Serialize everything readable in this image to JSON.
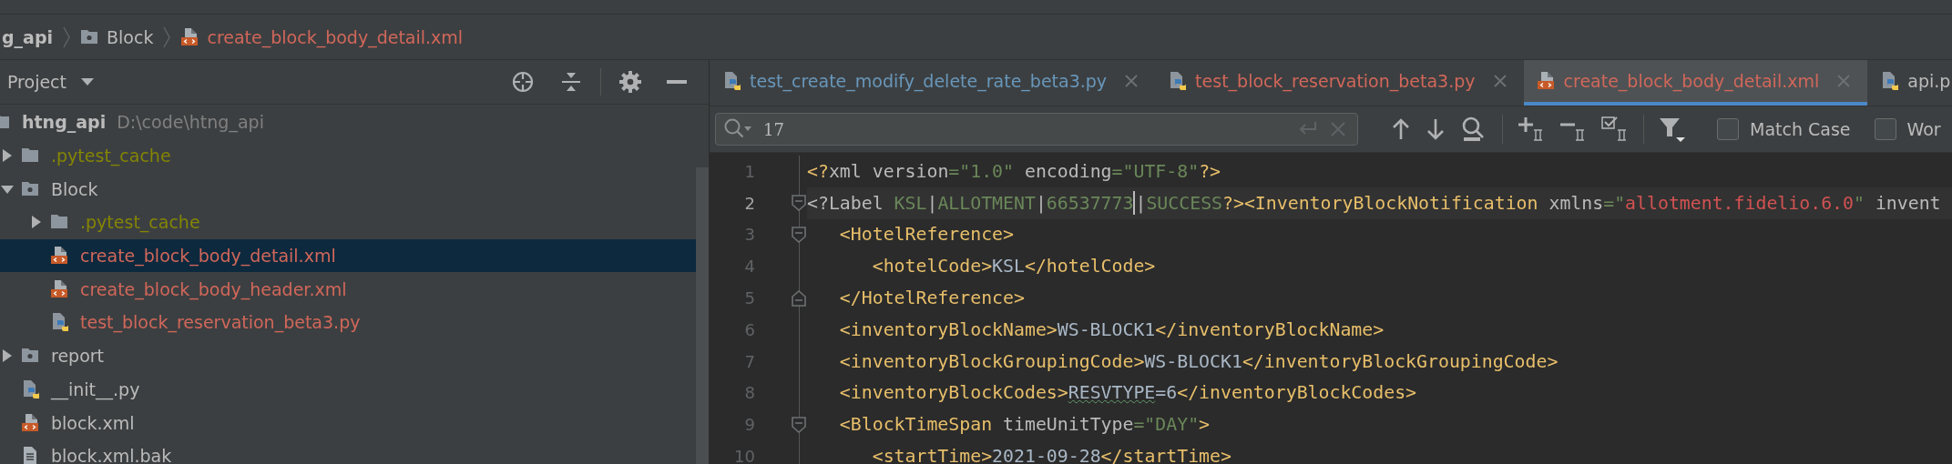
{
  "breadcrumbs": [
    {
      "label": "g_api",
      "color": "#bbbbbb"
    },
    {
      "label": "Block",
      "kind": "package",
      "color": "#bbbbbb"
    },
    {
      "label": "create_block_body_detail.xml",
      "kind": "xml",
      "color": "#d1675a"
    }
  ],
  "project_panel": {
    "title": "Project",
    "tree": [
      {
        "label": "htng_api",
        "path": "D:\\code\\htng_api",
        "kind": "folder",
        "color": "#bbbbbb",
        "selected": false,
        "children": [
          {
            "label": ".pytest_cache",
            "kind": "folder",
            "color": "#848504",
            "selected": false,
            "expanded": false
          },
          {
            "label": "Block",
            "kind": "package",
            "color": "#bbbbbb",
            "selected": false,
            "expanded": true,
            "children": [
              {
                "label": ".pytest_cache",
                "kind": "folder",
                "color": "#848504",
                "selected": false,
                "expanded": false
              },
              {
                "label": "create_block_body_detail.xml",
                "kind": "xml",
                "color": "#d1675a",
                "selected": true
              },
              {
                "label": "create_block_body_header.xml",
                "kind": "xml",
                "color": "#d1675a",
                "selected": false
              },
              {
                "label": "test_block_reservation_beta3.py",
                "kind": "python",
                "color": "#d1675a",
                "selected": false
              }
            ]
          },
          {
            "label": "report",
            "kind": "package",
            "color": "#bbbbbb",
            "selected": false,
            "expanded": false
          },
          {
            "label": "__init__.py",
            "kind": "python",
            "color": "#bbbbbb",
            "selected": false
          },
          {
            "label": "block.xml",
            "kind": "xml",
            "color": "#bbbbbb",
            "selected": false
          },
          {
            "label": "block.xml.bak",
            "kind": "text",
            "color": "#bbbbbb",
            "selected": false
          }
        ]
      }
    ]
  },
  "editor_tabs": [
    {
      "label": "test_create_modify_delete_rate_beta3.py",
      "kind": "python",
      "color": "#6897bb",
      "selected": false,
      "closable": true
    },
    {
      "label": "test_block_reservation_beta3.py",
      "kind": "python",
      "color": "#d1675a",
      "selected": false,
      "closable": true
    },
    {
      "label": "create_block_body_detail.xml",
      "kind": "xml",
      "color": "#d1675a",
      "selected": true,
      "closable": true
    },
    {
      "label": "api.p",
      "kind": "python",
      "color": "#bbbbbb",
      "selected": false,
      "closable": false
    }
  ],
  "find_bar": {
    "query": "17",
    "options": [
      {
        "label": "Match Case",
        "checked": false
      },
      {
        "label": "Wor",
        "checked": false
      }
    ]
  },
  "editor": {
    "lines": [
      {
        "number": "1",
        "current": false,
        "tokens": [
          {
            "kind": "tag",
            "text": "<?"
          },
          {
            "kind": "attr",
            "text": "xml version"
          },
          {
            "kind": "value",
            "text": "=\"1.0\""
          },
          {
            "kind": "attr",
            "text": " encoding"
          },
          {
            "kind": "value",
            "text": "=\"UTF-8\""
          },
          {
            "kind": "tag",
            "text": "?>"
          }
        ]
      },
      {
        "number": "2",
        "current": true,
        "expanded": true,
        "tokens": [
          {
            "kind": "attr",
            "text": "<?Label "
          },
          {
            "kind": "value",
            "text": "KSL"
          },
          {
            "kind": "attr",
            "text": "|"
          },
          {
            "kind": "value",
            "text": "ALLOTMENT"
          },
          {
            "kind": "attr",
            "text": "|"
          },
          {
            "kind": "value",
            "text": "66537773",
            "caret": true
          },
          {
            "kind": "attr",
            "text": "|"
          },
          {
            "kind": "value",
            "text": "SUCCESS"
          },
          {
            "kind": "tag",
            "text": "?><InventoryBlockNotification"
          },
          {
            "kind": "attr",
            "text": " xmlns"
          },
          {
            "kind": "value",
            "text": "=\""
          },
          {
            "kind": "url",
            "text": "allotment.fidelio.6.0"
          },
          {
            "kind": "value",
            "text": "\""
          },
          {
            "kind": "attr",
            "text": " invent"
          }
        ]
      },
      {
        "number": "3",
        "current": false,
        "expanded": true,
        "tokens": [
          {
            "kind": "tag",
            "text": "   <HotelReference>"
          }
        ]
      },
      {
        "number": "4",
        "current": false,
        "tokens": [
          {
            "kind": "tag",
            "text": "      <hotelCode>"
          },
          {
            "kind": "text",
            "text": "KSL"
          },
          {
            "kind": "tag",
            "text": "</hotelCode>"
          }
        ]
      },
      {
        "number": "5",
        "current": false,
        "fold_end": true,
        "tokens": [
          {
            "kind": "tag",
            "text": "   </HotelReference>"
          }
        ]
      },
      {
        "number": "6",
        "current": false,
        "tokens": [
          {
            "kind": "tag",
            "text": "   <inventoryBlockName>"
          },
          {
            "kind": "text",
            "text": "WS-BLOCK1"
          },
          {
            "kind": "tag",
            "text": "</inventoryBlockName>"
          }
        ]
      },
      {
        "number": "7",
        "current": false,
        "tokens": [
          {
            "kind": "tag",
            "text": "   <inventoryBlockGroupingCode>"
          },
          {
            "kind": "text",
            "text": "WS-BLOCK1"
          },
          {
            "kind": "tag",
            "text": "</inventoryBlockGroupingCode>"
          }
        ]
      },
      {
        "number": "8",
        "current": false,
        "tokens": [
          {
            "kind": "tag",
            "text": "   <inventoryBlockCodes>"
          },
          {
            "kind": "text",
            "text": "RESVTYPE",
            "typo": true
          },
          {
            "kind": "text",
            "text": "=6"
          },
          {
            "kind": "tag",
            "text": "</inventoryBlockCodes>"
          }
        ]
      },
      {
        "number": "9",
        "current": false,
        "expanded": true,
        "tokens": [
          {
            "kind": "tag",
            "text": "   <BlockTimeSpan"
          },
          {
            "kind": "attr",
            "text": " timeUnitType"
          },
          {
            "kind": "value",
            "text": "=\"DAY\""
          },
          {
            "kind": "tag",
            "text": ">"
          }
        ]
      },
      {
        "number": "10",
        "current": false,
        "tokens": [
          {
            "kind": "tag",
            "text": "      <startTime>"
          },
          {
            "kind": "text",
            "text": "2021-09-28"
          },
          {
            "kind": "tag",
            "text": "</startTime>"
          }
        ]
      }
    ]
  }
}
